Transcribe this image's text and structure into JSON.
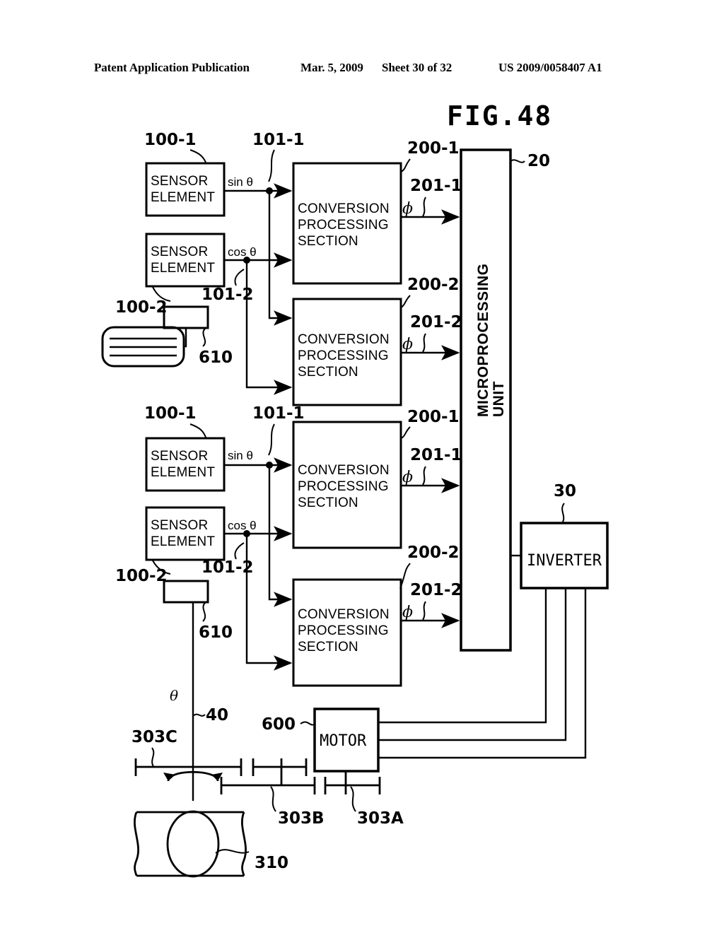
{
  "header": {
    "publication": "Patent Application Publication",
    "date": "Mar. 5, 2009",
    "sheet": "Sheet 30 of 32",
    "patent_number": "US 2009/0058407 A1"
  },
  "figure": {
    "title": "FIG.48"
  },
  "labels": {
    "sensor_element": "SENSOR ELEMENT",
    "conversion_processing_section": "CONVERSION PROCESSING SECTION",
    "microprocessing_unit": "MICROPROCESSING UNIT",
    "inverter": "INVERTER",
    "motor": "MOTOR",
    "sin_theta": "sin θ",
    "cos_theta": "cos θ",
    "phi": "ϕ",
    "theta": "θ"
  },
  "reference_numerals": {
    "sensor_1": "100-1",
    "sensor_2": "100-2",
    "signal_1": "101-1",
    "signal_2": "101-2",
    "conversion_1": "200-1",
    "conversion_2": "200-2",
    "output_1": "201-1",
    "output_2": "201-2",
    "mpu": "20",
    "inverter": "30",
    "shaft": "40",
    "magnet": "610",
    "motor": "600",
    "gear_a": "303A",
    "gear_b": "303B",
    "gear_c": "303C",
    "valve": "310"
  },
  "blocks": [
    {
      "name": "sensor-element-1a",
      "label": "SENSOR ELEMENT",
      "ref": "100-1"
    },
    {
      "name": "sensor-element-1b",
      "label": "SENSOR ELEMENT",
      "ref": "100-2"
    },
    {
      "name": "conversion-section-1",
      "label": "CONVERSION PROCESSING SECTION",
      "ref": "200-1"
    },
    {
      "name": "conversion-section-2",
      "label": "CONVERSION PROCESSING SECTION",
      "ref": "200-2"
    },
    {
      "name": "sensor-element-2a",
      "label": "SENSOR ELEMENT",
      "ref": "100-1"
    },
    {
      "name": "sensor-element-2b",
      "label": "SENSOR ELEMENT",
      "ref": "100-2"
    },
    {
      "name": "conversion-section-3",
      "label": "CONVERSION PROCESSING SECTION",
      "ref": "200-1"
    },
    {
      "name": "conversion-section-4",
      "label": "CONVERSION PROCESSING SECTION",
      "ref": "200-2"
    },
    {
      "name": "microprocessing-unit",
      "label": "MICROPROCESSING UNIT",
      "ref": "20"
    },
    {
      "name": "inverter",
      "label": "INVERTER",
      "ref": "30"
    },
    {
      "name": "motor",
      "label": "MOTOR",
      "ref": "600"
    }
  ],
  "colors": {
    "ink": "#000000",
    "paper": "#ffffff"
  }
}
